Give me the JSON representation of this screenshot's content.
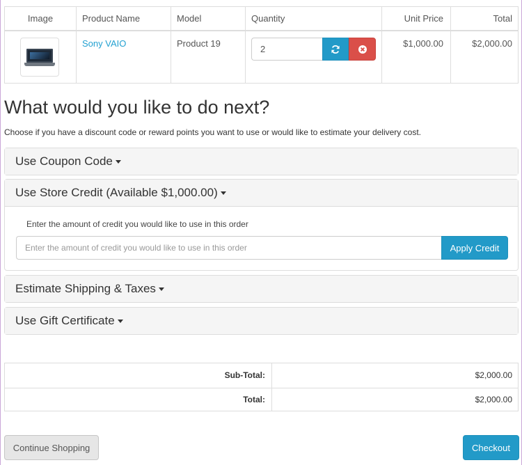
{
  "cart": {
    "headers": {
      "image": "Image",
      "product_name": "Product Name",
      "model": "Model",
      "quantity": "Quantity",
      "unit_price": "Unit Price",
      "total": "Total"
    },
    "items": [
      {
        "image_icon": "laptop-thumbnail",
        "product_name": "Sony VAIO",
        "model": "Product 19",
        "quantity": "2",
        "unit_price": "$1,000.00",
        "total": "$2,000.00"
      }
    ],
    "icons": {
      "update": "refresh-icon",
      "remove": "times-circle-icon"
    }
  },
  "next": {
    "title": "What would you like to do next?",
    "description": "Choose if you have a discount code or reward points you want to use or would like to estimate your delivery cost."
  },
  "panels": {
    "coupon": {
      "title": "Use Coupon Code"
    },
    "credit": {
      "title": "Use Store Credit (Available $1,000.00)",
      "label": "Enter the amount of credit you would like to use in this order",
      "placeholder": "Enter the amount of credit you would like to use in this order",
      "button": "Apply Credit"
    },
    "shipping": {
      "title": "Estimate Shipping & Taxes"
    },
    "gift": {
      "title": "Use Gift Certificate"
    }
  },
  "totals": [
    {
      "label": "Sub-Total:",
      "value": "$2,000.00"
    },
    {
      "label": "Total:",
      "value": "$2,000.00"
    }
  ],
  "buttons": {
    "continue": "Continue Shopping",
    "checkout": "Checkout"
  },
  "colors": {
    "primary": "#229ac8",
    "danger": "#da4f49",
    "link": "#23a1d1"
  }
}
